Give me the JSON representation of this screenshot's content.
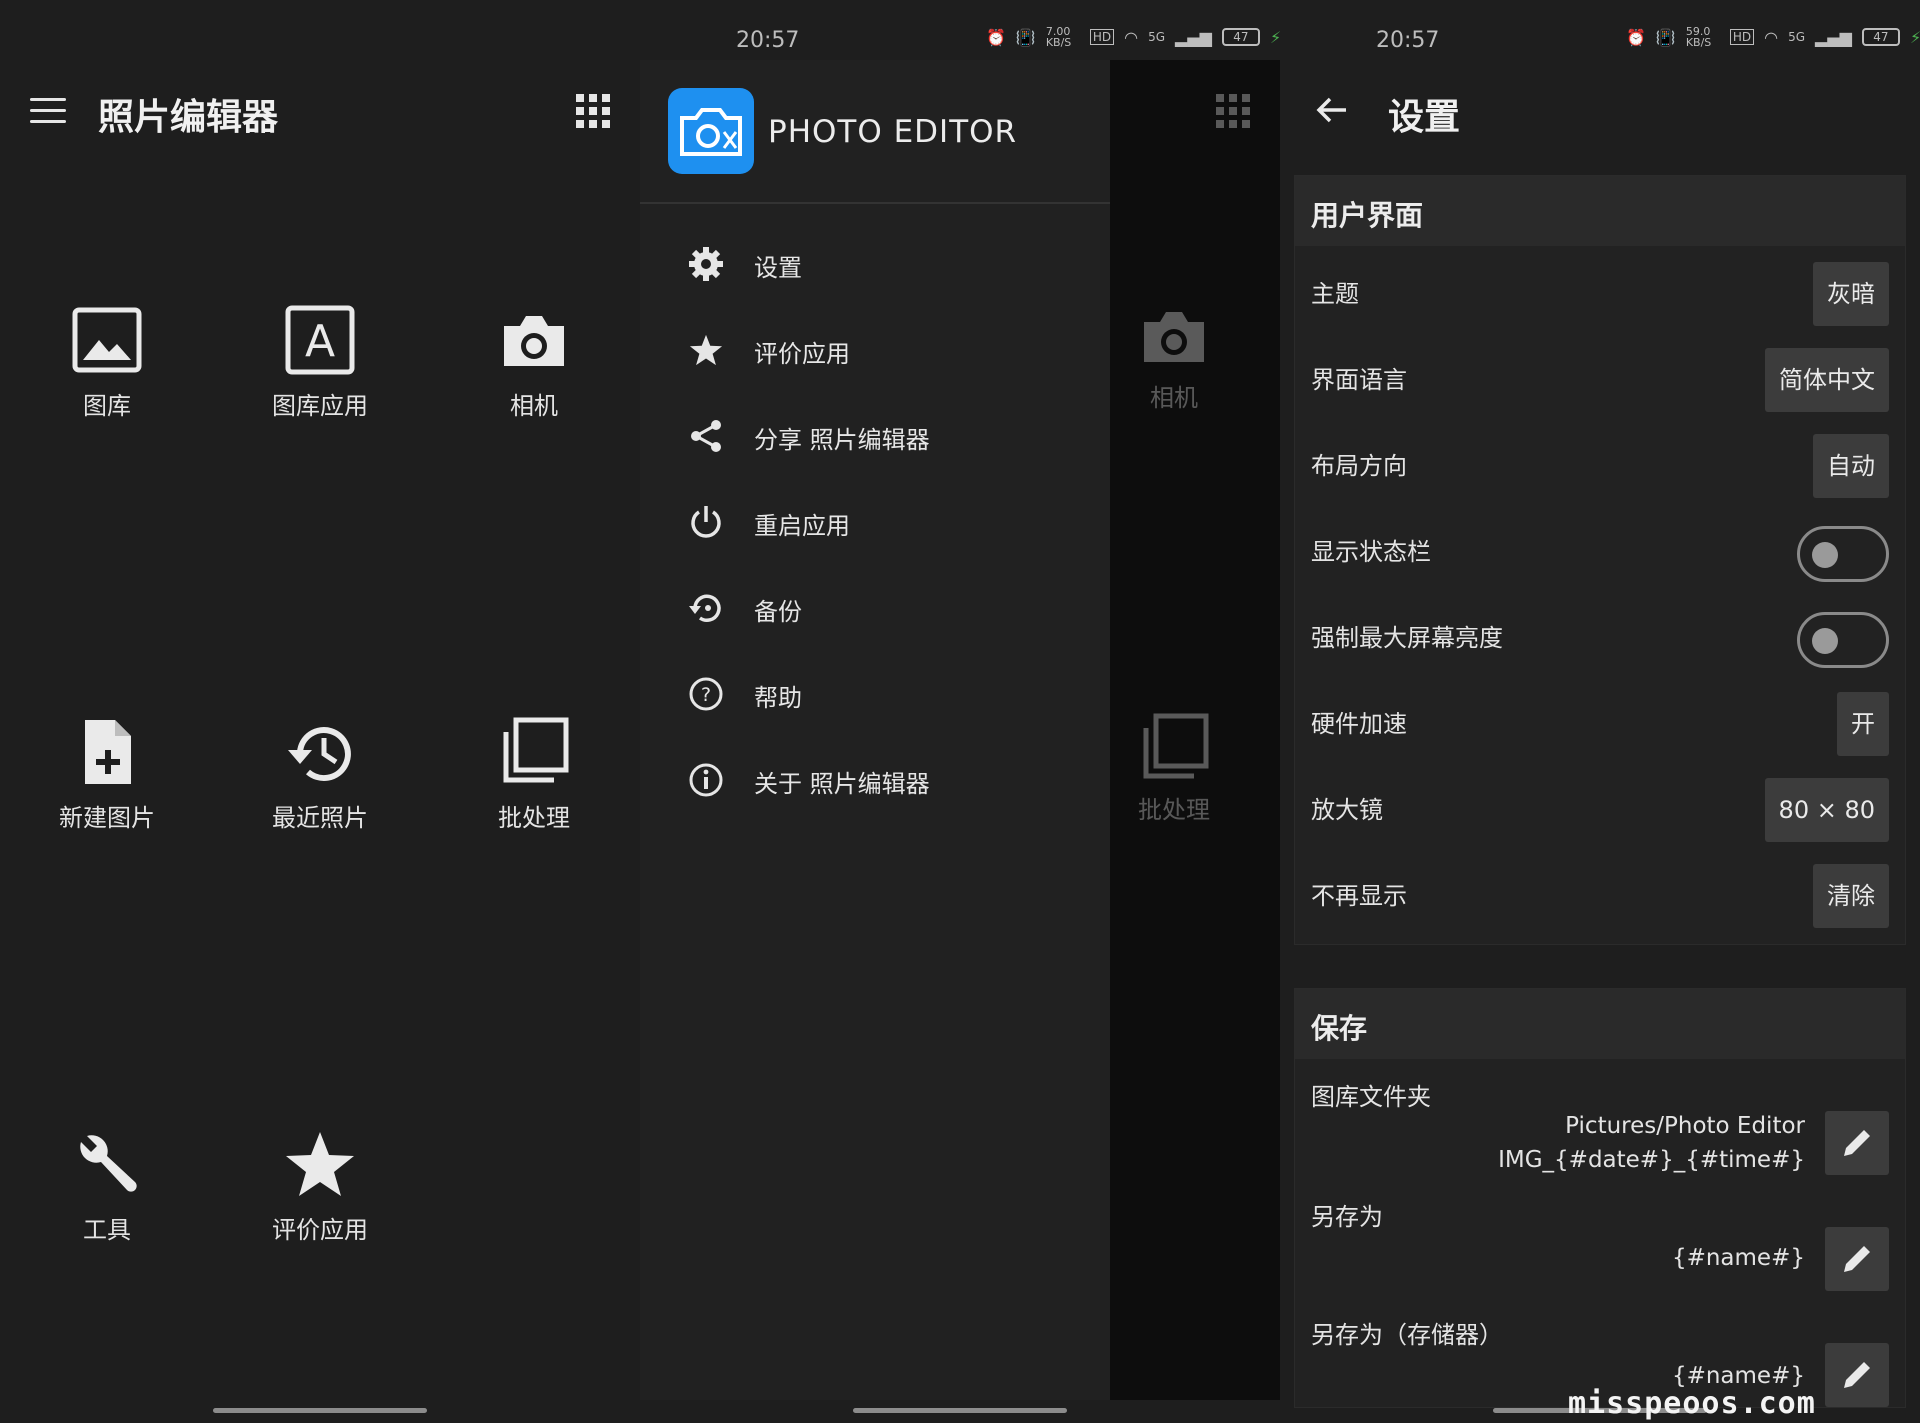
{
  "status": {
    "time": "20:57",
    "speed_left": "7.00 KB/S",
    "speed_right": "59.0 KB/S",
    "net": "5G",
    "hd": "HD",
    "battery": "47"
  },
  "main": {
    "title": "照片编辑器",
    "tiles": [
      {
        "label": "图库",
        "icon": "image-icon"
      },
      {
        "label": "图库应用",
        "icon": "letter-a-icon"
      },
      {
        "label": "相机",
        "icon": "camera-icon"
      },
      {
        "label": "新建图片",
        "icon": "new-file-icon"
      },
      {
        "label": "最近照片",
        "icon": "history-icon"
      },
      {
        "label": "批处理",
        "icon": "batch-icon"
      },
      {
        "label": "工具",
        "icon": "wrench-icon"
      },
      {
        "label": "评价应用",
        "icon": "star-icon"
      }
    ]
  },
  "drawer": {
    "title": "PHOTO EDITOR",
    "items": [
      {
        "label": "设置",
        "icon": "gear-icon"
      },
      {
        "label": "评价应用",
        "icon": "star-icon"
      },
      {
        "label": "分享 照片编辑器",
        "icon": "share-icon"
      },
      {
        "label": "重启应用",
        "icon": "power-icon"
      },
      {
        "label": "备份",
        "icon": "backup-icon"
      },
      {
        "label": "帮助",
        "icon": "help-icon"
      },
      {
        "label": "关于 照片编辑器",
        "icon": "info-icon"
      }
    ],
    "behind_tiles": [
      {
        "label": "相机"
      },
      {
        "label": "批处理"
      }
    ]
  },
  "settings": {
    "title": "设置",
    "ui_section": {
      "header": "用户界面",
      "rows": [
        {
          "label": "主题",
          "value": "灰暗"
        },
        {
          "label": "界面语言",
          "value": "简体中文"
        },
        {
          "label": "布局方向",
          "value": "自动"
        },
        {
          "label": "显示状态栏",
          "toggle": false
        },
        {
          "label": "强制最大屏幕亮度",
          "toggle": false
        },
        {
          "label": "硬件加速",
          "value": "开"
        },
        {
          "label": "放大镜",
          "value": "80 × 80"
        },
        {
          "label": "不再显示",
          "value": "清除"
        }
      ]
    },
    "save_section": {
      "header": "保存",
      "gallery_folder": {
        "label": "图库文件夹",
        "value1": "Pictures/Photo Editor",
        "value2": "IMG_{#date#}_{#time#}"
      },
      "save_as": {
        "label": "另存为",
        "value": "{#name#}"
      },
      "save_as_storage": {
        "label": "另存为（存储器）",
        "value": "{#name#}"
      }
    }
  },
  "watermark": "misspeoos.com"
}
